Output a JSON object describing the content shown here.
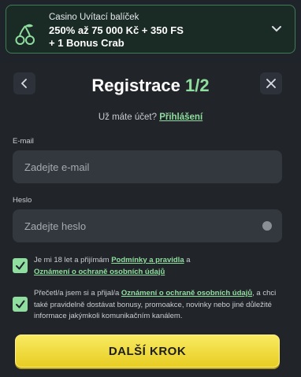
{
  "promo": {
    "subtitle": "Casino Uvítací balíček",
    "title_line1": "250% až 75 000 Kč + 350 FS",
    "title_line2": "+ 1 Bonus Crab",
    "icon": "cherry-icon",
    "accent": "#8fde9f"
  },
  "header": {
    "title": "Registrace",
    "step": "1/2",
    "back_icon": "chevron-left-icon",
    "close_icon": "close-icon"
  },
  "login": {
    "prompt": "Už máte účet?",
    "link": "Přihlášení"
  },
  "form": {
    "email_label": "E-mail",
    "email_placeholder": "Zadejte e-mail",
    "password_label": "Heslo",
    "password_placeholder": "Zadejte heslo"
  },
  "consents": {
    "age": {
      "text_before": "Je mi 18 let a přijímám",
      "link1": "Podmínky a pravidla",
      "text_mid": "a",
      "link2": "Oznámení o ochraně osobních údajů",
      "checked": true
    },
    "marketing": {
      "text_before": "Přečetl/a jsem si a přijal/a",
      "link": "Oznámení o ochraně osobních údajů",
      "text_after": ", a chci také pravidelně dostávat bonusy, promoakce, novinky nebo jiné důležité informace jakýmkoli komunikačním kanálem.",
      "checked": true
    }
  },
  "cta": {
    "label": "DALŠÍ KROK"
  },
  "colors": {
    "background": "#1f232a",
    "field": "#33373e",
    "accent_green": "#8fde9f",
    "cta_yellow": "#f1dc3f"
  }
}
